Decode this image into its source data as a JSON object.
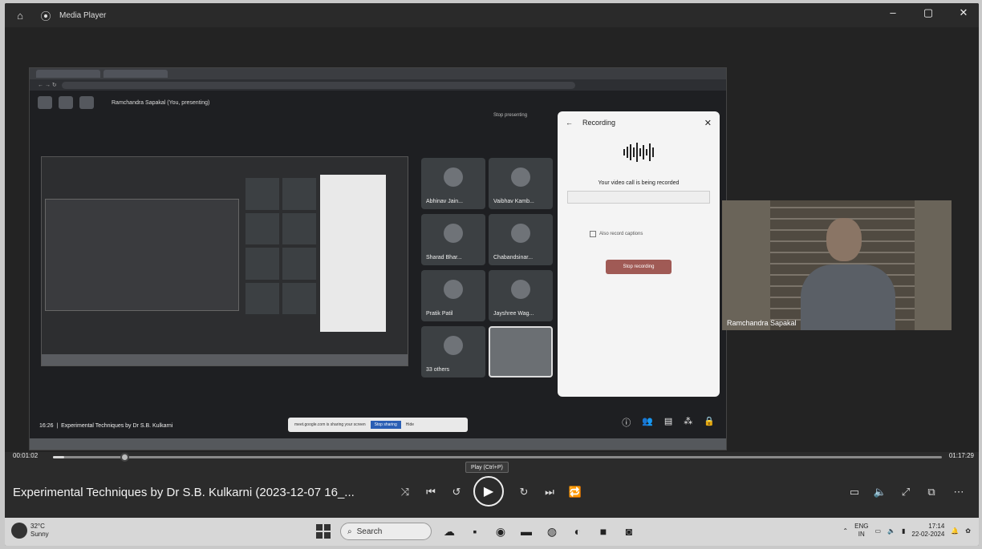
{
  "app": {
    "title": "Media Player",
    "window_controls": {
      "minimize": "–",
      "maximize": "▢",
      "close": "✕"
    }
  },
  "video_frame": {
    "meet": {
      "presenting_label": "Ramchandra Sapakal (You, presenting)",
      "stop_presenting": "Stop presenting",
      "participants": [
        {
          "name": "Abhinav Jain..."
        },
        {
          "name": "Vaibhav Kamb..."
        },
        {
          "name": "Sharad Bhar..."
        },
        {
          "name": "Chabandsinar..."
        },
        {
          "name": "Pratik Patil"
        },
        {
          "name": "Jayshree Wag..."
        },
        {
          "name": "33 others"
        }
      ],
      "recording_panel": {
        "title": "Recording",
        "message": "Your video call is being recorded",
        "stop_button": "Stop recording",
        "captions_label": "Also record captions"
      },
      "footer_time": "16:26",
      "footer_title": "Experimental Techniques by Dr S.B. Kulkarni",
      "share_banner": "meet.google.com is sharing your screen",
      "share_stop": "Stop sharing",
      "share_hide": "Hide"
    },
    "webcam_name": "Ramchandra Sapakal"
  },
  "player": {
    "current_time": "00:01:02",
    "total_time": "01:17:29",
    "progress": 0.013,
    "tooltip": "Play (Ctrl+P)",
    "title": "Experimental Techniques  by Dr S.B. Kulkarni  (2023-12-07 16_...",
    "controls": {
      "shuffle": "⤨",
      "previous": "⏮",
      "skip_back": "↺",
      "play": "▶",
      "skip_forward": "↻",
      "next": "⏭",
      "repeat": "🔁",
      "miniplayer": "▭",
      "volume": "🔈",
      "fullscreen": "⤢",
      "cast": "⧉",
      "more": "⋯"
    }
  },
  "taskbar": {
    "weather_temp": "32°C",
    "weather_desc": "Sunny",
    "search_placeholder": "Search",
    "lang_line1": "ENG",
    "lang_line2": "IN",
    "time": "17:14",
    "date": "22-02-2024"
  }
}
